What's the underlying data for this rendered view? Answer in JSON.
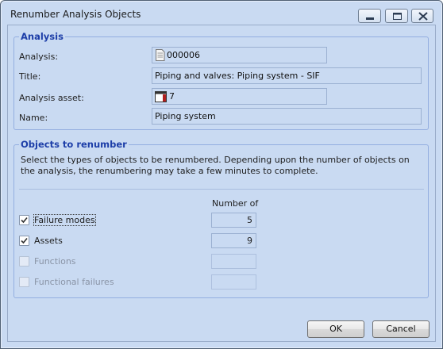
{
  "window": {
    "title": "Renumber Analysis Objects",
    "controls": {
      "minimize": "minimize-icon",
      "maximize": "maximize-icon",
      "close": "close-icon"
    }
  },
  "analysis": {
    "group_title": "Analysis",
    "analysis_label": "Analysis:",
    "analysis_value": "000006",
    "analysis_icon": "document-icon",
    "title_label": "Title:",
    "title_value": "Piping and valves: Piping system - SIF",
    "asset_label": "Analysis asset:",
    "asset_value": "7",
    "asset_icon": "asset-icon",
    "name_label": "Name:",
    "name_value": "Piping system"
  },
  "objects": {
    "group_title": "Objects to renumber",
    "description": "Select the types of objects to be renumbered.  Depending upon the number of objects on the analysis, the  renumbering may take a few minutes to complete.",
    "column_header": "Number of",
    "rows": [
      {
        "label": "Failure modes",
        "checked": true,
        "enabled": true,
        "count": "5"
      },
      {
        "label": "Assets",
        "checked": true,
        "enabled": true,
        "count": "9"
      },
      {
        "label": "Functions",
        "checked": false,
        "enabled": false,
        "count": ""
      },
      {
        "label": "Functional failures",
        "checked": false,
        "enabled": false,
        "count": ""
      }
    ]
  },
  "buttons": {
    "ok": "OK",
    "cancel": "Cancel"
  }
}
